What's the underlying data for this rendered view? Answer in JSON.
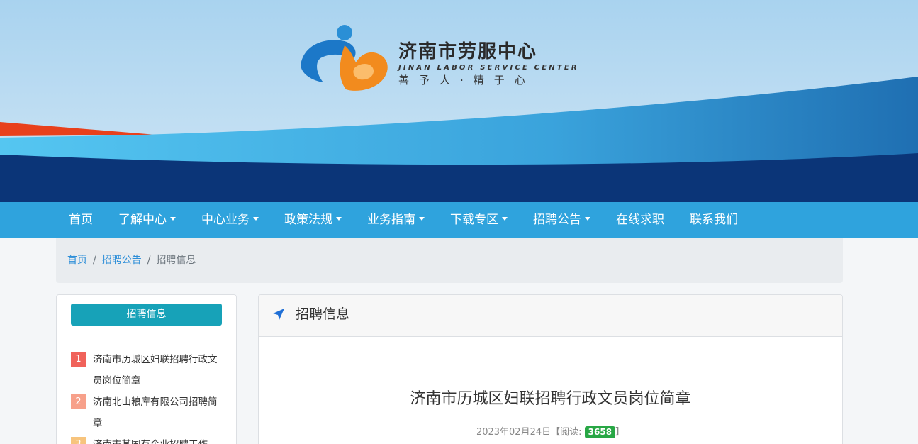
{
  "logo": {
    "title": "济南市劳服中心",
    "english": "JINAN LABOR SERVICE CENTER",
    "slogan": "善予人·精于心"
  },
  "nav": {
    "items": [
      {
        "label": "首页",
        "dropdown": false
      },
      {
        "label": "了解中心",
        "dropdown": true
      },
      {
        "label": "中心业务",
        "dropdown": true
      },
      {
        "label": "政策法规",
        "dropdown": true
      },
      {
        "label": "业务指南",
        "dropdown": true
      },
      {
        "label": "下载专区",
        "dropdown": true
      },
      {
        "label": "招聘公告",
        "dropdown": true
      },
      {
        "label": "在线求职",
        "dropdown": false
      },
      {
        "label": "联系我们",
        "dropdown": false
      }
    ]
  },
  "breadcrumb": {
    "home": "首页",
    "parent": "招聘公告",
    "separator": "/",
    "current": "招聘信息"
  },
  "sidebar": {
    "button_label": "招聘信息",
    "items": [
      {
        "rank": "1",
        "title": "济南市历城区妇联招聘行政文员岗位简章"
      },
      {
        "rank": "2",
        "title": "济南北山粮库有限公司招聘简章"
      },
      {
        "rank": "3",
        "title": "济南市某国有企业招聘工作"
      }
    ]
  },
  "main": {
    "header_title": "招聘信息",
    "article_title": "济南市历城区妇联招聘行政文员岗位简章",
    "date": "2023年02月24日",
    "read_prefix": "【阅读:",
    "read_count": "3658",
    "read_suffix": "】"
  },
  "colors": {
    "nav_bg": "#2fa3dd",
    "sidebar_button": "#17a2b8",
    "read_badge": "#28a745",
    "banner_dark": "#0b3578",
    "banner_light": "#54c3ef",
    "banner_red": "#e8401c"
  },
  "icons": {
    "header_icon": "location-arrow-icon",
    "nav_caret": "caret-down-icon"
  }
}
